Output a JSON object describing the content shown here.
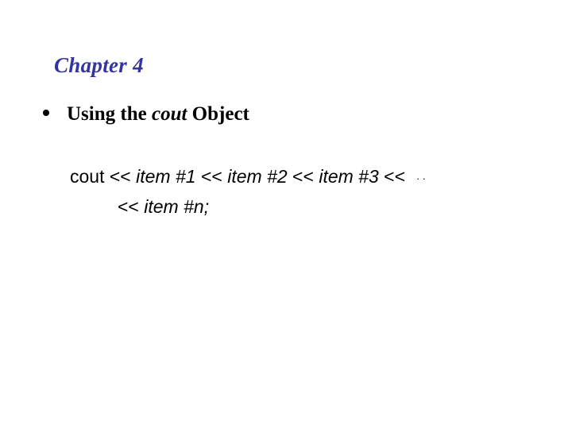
{
  "slide": {
    "background_color": "#ffffff",
    "title": {
      "text": "Chapter 4",
      "color": "#3333a3"
    },
    "bullet": {
      "marker": "bullet-point",
      "prefix": "Using the ",
      "keyword": "cout",
      "suffix": " Object",
      "full_text": "Using the cout Object"
    },
    "code": {
      "line1": {
        "obj": "cout ",
        "op1": "<< ",
        "item1": "item #1",
        "op2": " << ",
        "item2": "item #2",
        "op3": " << ",
        "item3": "item #3",
        "op4": " << ",
        "ellipsis": "..",
        "full_text": "cout << item #1 << item #2 << item #3 <<  .."
      },
      "line2": {
        "op": "<< ",
        "item": " item #n;",
        "full_text": "<<  item #n;"
      }
    }
  }
}
